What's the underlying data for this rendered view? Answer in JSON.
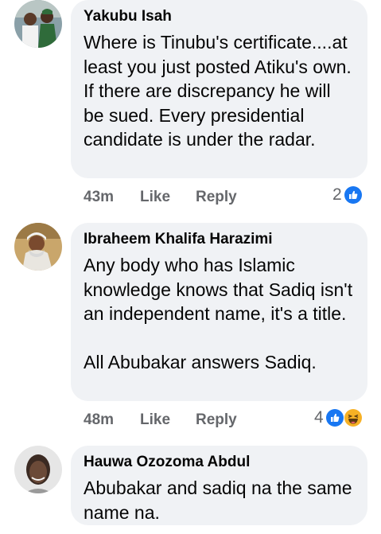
{
  "comments": [
    {
      "author": "Yakubu Isah",
      "text": "Where is Tinubu's certificate....at least you just posted Atiku's own. If there are discrepancy he will be sued. Every presidential candidate is under the radar.",
      "time": "43m",
      "like_label": "Like",
      "reply_label": "Reply",
      "reaction_count": "2",
      "reactions": [
        "like-icon"
      ]
    },
    {
      "author": "Ibraheem Khalifa Harazimi",
      "text": "Any body who has Islamic knowledge knows that Sadiq isn't an independent name, it's a title.\n\nAll Abubakar answers Sadiq.",
      "time": "48m",
      "like_label": "Like",
      "reply_label": "Reply",
      "reaction_count": "4",
      "reactions": [
        "like-icon",
        "haha-icon"
      ]
    },
    {
      "author": "Hauwa Ozozoma Abdul",
      "text": "Abubakar and sadiq na the same name na."
    }
  ],
  "colors": {
    "bubble": "#f0f2f5",
    "like_blue": "#1877f2",
    "haha_yellow": "#f7b125",
    "meta_gray": "#65676b"
  }
}
